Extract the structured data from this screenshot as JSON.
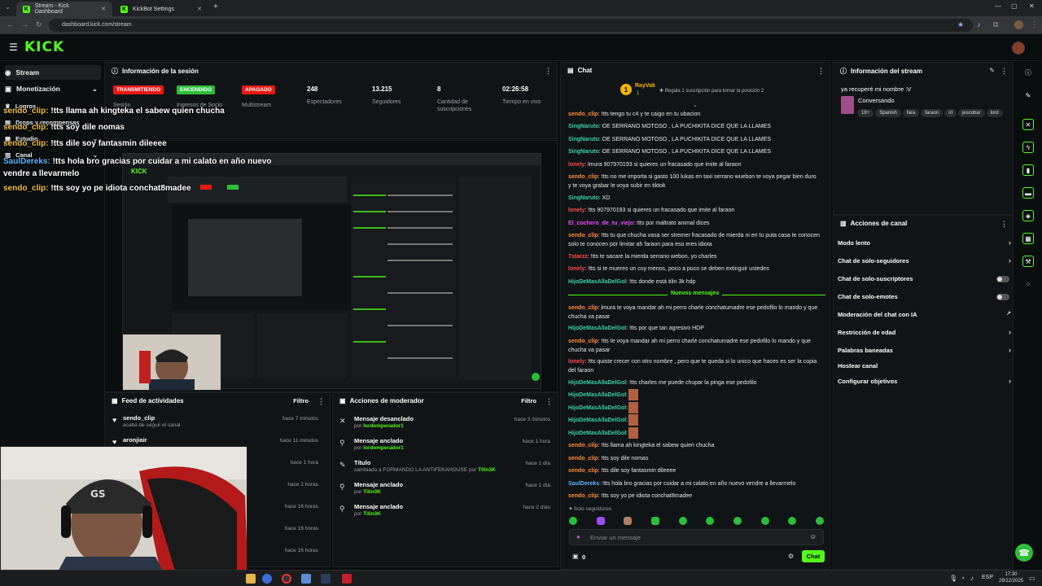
{
  "browser": {
    "tabs": [
      {
        "label": "Stream - Kick Dashboard",
        "active": true
      },
      {
        "label": "KickBot Settings",
        "active": false
      }
    ],
    "url": "dashboard.kick.com/stream"
  },
  "brand": {
    "logo": "KICK",
    "accent": "#53fc18"
  },
  "sidebar": {
    "items": [
      {
        "label": "Stream",
        "active": true
      },
      {
        "label": "Monetización"
      },
      {
        "label": "Logros"
      },
      {
        "label": "Drops y recompensas"
      },
      {
        "label": "Estudio"
      },
      {
        "label": "Canal"
      }
    ]
  },
  "overlay_chat": [
    {
      "user": "sendo_clip:",
      "text": "!tts llama ah kingteka el sabew quien chucha"
    },
    {
      "user": "sendo_clip:",
      "text": "!tts soy dile nomas"
    },
    {
      "user": "sendo_clip:",
      "text": "!tts dile soy fantasmin dileeee"
    },
    {
      "user": "SaulDereks:",
      "text": "!tts hola bro gracias por cuidar a mi calato en año nuevo vendre a llevarmelo"
    },
    {
      "user": "sendo_clip:",
      "text": "!tts soy yo pe idiota conchat8madee"
    }
  ],
  "session": {
    "title": "Información de la sesión",
    "stats": [
      {
        "value": "TRANSMITIENDO",
        "label": "Sesión",
        "color": "#e91916"
      },
      {
        "value": "ENCENDIDO",
        "label": "Ingresos de Socio",
        "color": "#2dbd3a"
      },
      {
        "value": "APAGADO",
        "label": "Multistream",
        "color": "#e91916"
      },
      {
        "value": "248",
        "label": "Espectadores"
      },
      {
        "value": "13.215",
        "label": "Seguidores"
      },
      {
        "value": "8",
        "label": "Cantidad de suscripciones"
      },
      {
        "value": "02:26:58",
        "label": "Tiempo en vivo"
      }
    ]
  },
  "feed": {
    "title": "Feed de actividades",
    "filter": "Filtro",
    "rows": [
      {
        "name": "sendo_clip",
        "sub": "acaba de seguir el canal",
        "time": "hace 7 minutos"
      },
      {
        "name": "aronjiair",
        "sub": "",
        "time": "hace 11 minutos"
      },
      {
        "name": "",
        "sub": "",
        "time": "hace 1 hora"
      },
      {
        "name": "",
        "sub": "",
        "time": "hace 2 horas"
      },
      {
        "name": "",
        "sub": "",
        "time": "hace 16 horas"
      },
      {
        "name": "",
        "sub": "",
        "time": "hace 16 horas"
      },
      {
        "name": "",
        "sub": "",
        "time": "hace 16 horas"
      }
    ]
  },
  "moderator": {
    "title": "Acciones de moderador",
    "filter": "Filtro",
    "rows": [
      {
        "title": "Mensaje desanclado",
        "by_prefix": "por",
        "by": "lordemperador1",
        "time": "hace 3 minutos",
        "icon": "unpin-icon"
      },
      {
        "title": "Mensaje anclado",
        "by_prefix": "por",
        "by": "lordemperador1",
        "time": "hace 1 hora",
        "icon": "pin-icon"
      },
      {
        "title": "Título",
        "by_prefix": "cambiado a FORMANDO LA ANTIFEKAHOUSE por",
        "by": "Tilin3K",
        "time": "hace 1 día",
        "icon": "title-icon"
      },
      {
        "title": "Mensaje anclado",
        "by_prefix": "por",
        "by": "Tilin3K",
        "time": "hace 1 día",
        "icon": "pin-icon"
      },
      {
        "title": "Mensaje anclado",
        "by_prefix": "por",
        "by": "Tilin3K",
        "time": "hace 2 días",
        "icon": "pin-icon"
      }
    ]
  },
  "chat": {
    "title": "Chat",
    "pinned_user": "RayVak",
    "pinned_count": "1",
    "gift_text": "Regala 1 suscripción para tomar la posición 2",
    "new_messages_label": "Nuevos mensajes",
    "followers_only": "Solo seguidores",
    "input_placeholder": "Enviar un mensaje",
    "send_label": "Chat",
    "points": "0",
    "messages": [
      {
        "user": "sendo_clip",
        "c": "u-o",
        "text": "!tts tengo tu c4 y te caigo en tu ubacion"
      },
      {
        "user": "SingNaruto",
        "c": "u-t",
        "text": "OE SERRANO MOTOSO , LA PUCHIKITA DICE QUE LA LLAMES"
      },
      {
        "user": "SingNaruto",
        "c": "u-t",
        "text": "OE SERRANO MOTOSO , LA PUCHIKITA DICE QUE LA LLAMES"
      },
      {
        "user": "SingNaruto",
        "c": "u-t",
        "text": "OE SERRANO MOTOSO , LA PUCHIKITA DICE QUE LA LLAMES"
      },
      {
        "user": "lonely",
        "c": "u-r",
        "text": "lmura 907970193 si quieres un fracasado que imite al faraon"
      },
      {
        "user": "sendo_clip",
        "c": "u-o",
        "text": "!tts no me importa si gasto 100 lukas en taxi serrano wuebon te voya pegar bien duro y te voya grabar le voya subir en tiktok"
      },
      {
        "user": "SingNaruto",
        "c": "u-t",
        "text": "XD"
      },
      {
        "user": "lonely",
        "c": "u-r",
        "text": "!tts 907970193 si quieres un fracasado que imite al faraon"
      },
      {
        "user": "El_cochero_de_tu_viejo",
        "c": "u-p",
        "text": "!tts por maltrato animal dices"
      },
      {
        "user": "sendo_clip",
        "c": "u-o",
        "text": "!tts tu que chucha vasa ser stremer fracasado de mierda ni en tu puta casa te conocen solo te conocen por limitar ah faraon para eso eres idiota"
      },
      {
        "user": "7starzz",
        "c": "u-r",
        "text": "!tts te sacare la mierda serrano webon, yo charles"
      },
      {
        "user": "lonely",
        "c": "u-r",
        "text": "!tts si te mueres un cuy menos, poco a poco se deben extinguir ustedes"
      },
      {
        "user": "HijoDeMasAllaDelGol",
        "c": "u-t",
        "text": "!tts donde está tilin 3k hdp"
      },
      {
        "user": "sendo_clip",
        "c": "u-o",
        "text": "lmura te voya mandar ah mi perro charle conchatumadre ese pedofilo lo mando y que chucha va pasar"
      },
      {
        "user": "HijoDeMasAllaDelGol",
        "c": "u-t",
        "text": "!tts por que tan agresivo HDP"
      },
      {
        "user": "sendo_clip",
        "c": "u-o",
        "text": "!tts te voya mandar ah mi perro charle conchatumadre ese pedofilo lo mando y que chucha va pasar"
      },
      {
        "user": "lonely",
        "c": "u-r",
        "text": "!tts quiste crecer con otro nombre , pero que te queda si lo unico que haces es ser la copia del faraon"
      },
      {
        "user": "HijoDeMasAllaDelGol",
        "c": "u-t",
        "text": "!tts charles me puede chupar la pinga ese pedofilo"
      },
      {
        "user": "HijoDeMasAllaDelGol",
        "c": "u-t",
        "text": ""
      },
      {
        "user": "HijoDeMasAllaDelGol",
        "c": "u-t",
        "text": ""
      },
      {
        "user": "HijoDeMasAllaDelGol",
        "c": "u-t",
        "text": ""
      },
      {
        "user": "HijoDeMasAllaDelGol",
        "c": "u-t",
        "text": ""
      },
      {
        "user": "sendo_clip",
        "c": "u-o",
        "text": "!tts llama ah kingteka el sabew quien chucha"
      },
      {
        "user": "sendo_clip",
        "c": "u-o",
        "text": "!tts soy dile nomas"
      },
      {
        "user": "sendo_clip",
        "c": "u-o",
        "text": "!tts dile soy fantasmin dileeee"
      },
      {
        "user": "SaulDereks",
        "c": "u-b",
        "text": "!tts hola bro gracias por cuidar a mi calato en año nuevo vendre a llevarmelo"
      },
      {
        "user": "sendo_clip",
        "c": "u-o",
        "text": "!tts soy yo pe idiota conchat8madee"
      }
    ]
  },
  "stream_info": {
    "title": "Información del stream",
    "stream_title": "ya recuperé mi nombre :V",
    "category": "Conversando",
    "tags": [
      "18+",
      "Spanish",
      "fara",
      "faraon",
      "irl",
      "jescobar",
      "lord"
    ]
  },
  "channel_actions": {
    "title": "Acciones de canal",
    "items": [
      {
        "label": "Modo lento",
        "kind": "chevron"
      },
      {
        "label": "Chat de solo-seguidores",
        "kind": "chevron"
      },
      {
        "label": "Chat de solo-suscriptores",
        "kind": "toggle"
      },
      {
        "label": "Chat de solo-emotes",
        "kind": "toggle"
      },
      {
        "label": "Moderación del chat con IA",
        "kind": "external"
      },
      {
        "label": "Restricción de edad",
        "kind": "chevron"
      },
      {
        "label": "Palabras baneadas",
        "kind": "chevron"
      },
      {
        "label": "Hostear canal",
        "kind": "none"
      },
      {
        "label": "Configurar objetivos",
        "kind": "chevron"
      }
    ]
  },
  "taskbar": {
    "lang": "ESP",
    "time": "17:30",
    "date": "29/12/2025"
  }
}
